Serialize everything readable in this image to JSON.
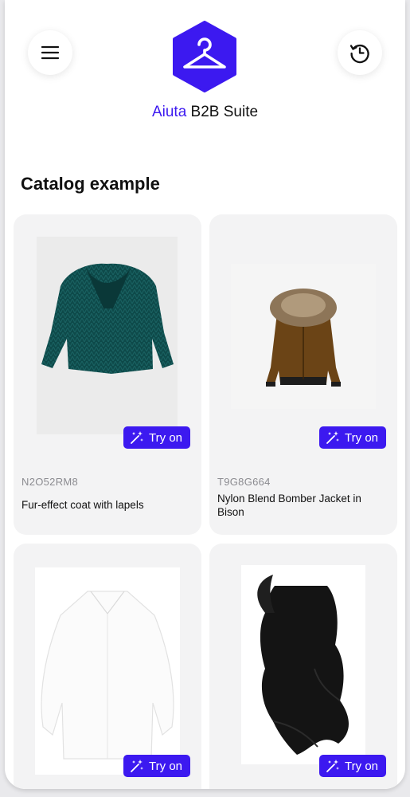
{
  "header": {
    "menu_icon": "hamburger-menu-icon",
    "history_icon": "history-clock-icon",
    "logo_icon": "hanger-logo-icon",
    "brand_accent": "Aiuta",
    "brand_rest": " B2B Suite",
    "accent_color": "#3c19f0"
  },
  "catalog": {
    "title": "Catalog example",
    "try_on_label": "Try on",
    "try_on_icon": "magic-sparkles-icon",
    "items": [
      {
        "sku": "N2O52RM8",
        "name": "Fur-effect coat with lapels"
      },
      {
        "sku": "T9G8G664",
        "name": "Nylon Blend Bomber Jacket in Bison"
      },
      {
        "sku": "",
        "name": ""
      },
      {
        "sku": "",
        "name": ""
      }
    ]
  }
}
